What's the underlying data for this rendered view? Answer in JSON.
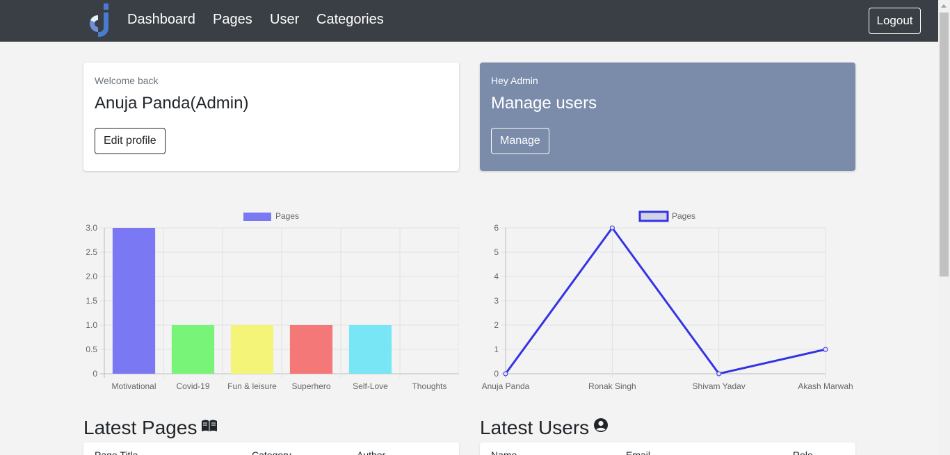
{
  "nav": {
    "links": [
      "Dashboard",
      "Pages",
      "User",
      "Categories"
    ],
    "logout": "Logout"
  },
  "welcome_card": {
    "small": "Welcome back",
    "name": "Anuja Panda(Admin)",
    "button": "Edit profile"
  },
  "admin_card": {
    "small": "Hey Admin",
    "title": "Manage users",
    "button": "Manage"
  },
  "chart_data": [
    {
      "type": "bar",
      "legend": "Pages",
      "categories": [
        "Motivational",
        "Covid-19",
        "Fun & leisure",
        "Superhero",
        "Self-Love",
        "Thoughts"
      ],
      "values": [
        3,
        1,
        1,
        1,
        1,
        0
      ],
      "colors": [
        "#7b78f4",
        "#78f478",
        "#f4f478",
        "#f47878",
        "#78e6f4",
        "#cccccc"
      ],
      "ylim": [
        0,
        3
      ],
      "yticks": [
        "0",
        "0.5",
        "1.0",
        "1.5",
        "2.0",
        "2.5",
        "3.0"
      ],
      "grid": true,
      "legend_position": "top"
    },
    {
      "type": "line",
      "legend": "Pages",
      "categories": [
        "Anuja Panda",
        "Ronak Singh",
        "Shivam Yadav",
        "Akash Marwah"
      ],
      "values": [
        0,
        6,
        0,
        1
      ],
      "color": "#3333e6",
      "ylim": [
        0,
        6
      ],
      "yticks": [
        "0",
        "1",
        "2",
        "3",
        "4",
        "5",
        "6"
      ],
      "grid": true,
      "legend_position": "top"
    }
  ],
  "latest_pages": {
    "title": "Latest Pages",
    "icon": "book-icon",
    "columns": [
      "Page Title",
      "Category",
      "Author"
    ]
  },
  "latest_users": {
    "title": "Latest Users",
    "icon": "user-circle-icon",
    "columns": [
      "Name",
      "Email",
      "Role"
    ]
  }
}
